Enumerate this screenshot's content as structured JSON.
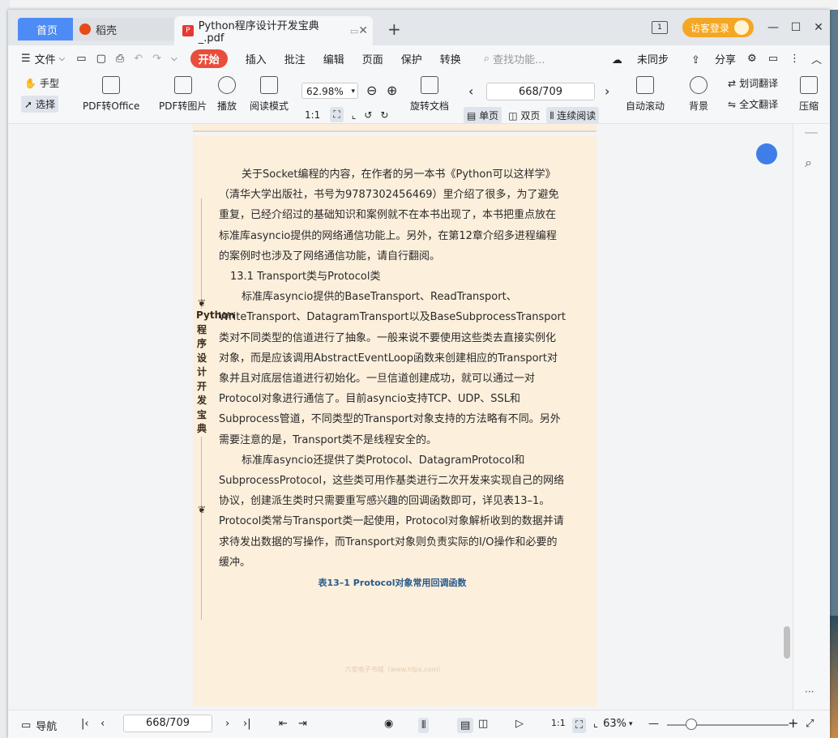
{
  "tabs": {
    "home": "首页",
    "daoke": "稻壳",
    "document": "Python程序设计开发宝典_.pdf",
    "add": "+"
  },
  "header": {
    "login": "访客登录",
    "minimize": "—",
    "maximize": "☐",
    "close": "✕"
  },
  "menu": {
    "file": "文件",
    "items": [
      "开始",
      "插入",
      "批注",
      "编辑",
      "页面",
      "保护",
      "转换"
    ],
    "search_placeholder": "查找功能...",
    "unsync": "未同步",
    "share": "分享"
  },
  "toolbar": {
    "hand": "手型",
    "select": "选择",
    "pdf_to_office": "PDF转Office",
    "pdf_to_image": "PDF转图片",
    "play": "播放",
    "read_mode": "阅读模式",
    "zoom": "62.98%",
    "rotate": "旋转文档",
    "page": "668/709",
    "single": "单页",
    "double": "双页",
    "continuous": "连续阅读",
    "autoscroll": "自动滚动",
    "background": "背景",
    "word_translate": "划词翻译",
    "full_translate": "全文翻译",
    "compress": "压缩"
  },
  "document": {
    "para1": "关于Socket编程的内容，在作者的另一本书《Python可以这样学》（清华大学出版社，书号为9787302456469）里介绍了很多，为了避免重复，已经介绍过的基础知识和案例就不在本书出现了，本书把重点放在标准库asyncio提供的网络通信功能上。另外，在第12章介绍多进程编程的案例时也涉及了网络通信功能，请自行翻阅。",
    "section": "13.1 Transport类与Protocol类",
    "para2": "标准库asyncio提供的BaseTransport、ReadTransport、WriteTransport、DatagramTransport以及BaseSubprocessTransport类对不同类型的信道进行了抽象。一般来说不要使用这些类去直接实例化对象，而是应该调用AbstractEventLoop函数来创建相应的Transport对象并且对底层信道进行初始化。一旦信道创建成功，就可以通过一对Protocol对象进行通信了。目前asyncio支持TCP、UDP、SSL和Subprocess管道，不同类型的Transport对象支持的方法略有不同。另外需要注意的是，Transport类不是线程安全的。",
    "para3": "标准库asyncio还提供了类Protocol、DatagramProtocol和SubprocessProtocol，这些类可用作基类进行二次开发来实现自己的网络协议，创建派生类时只需要重写感兴趣的回调函数即可，详见表13–1。Protocol类常与Transport类一起使用，Protocol对象解析收到的数据并请求待发出数据的写操作，而Transport对象则负责实际的I/O操作和必要的缓冲。",
    "caption": "表13–1 Protocol对象常用回调函数",
    "side_title": "Python程序设计开发宝典",
    "watermark": "六安电子书城（www.hfpx.com）"
  },
  "status": {
    "nav": "导航",
    "page": "668/709",
    "zoom": "63%"
  }
}
